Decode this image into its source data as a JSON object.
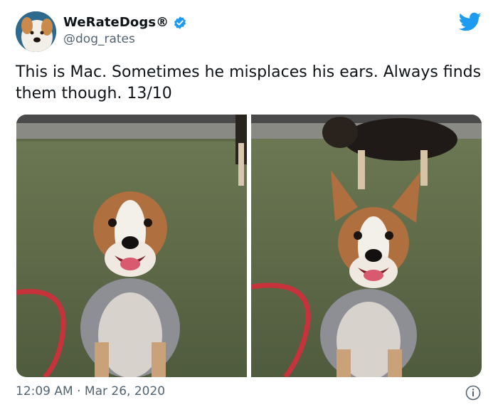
{
  "tweet": {
    "display_name": "WeRateDogs®",
    "handle": "@dog_rates",
    "verified": true,
    "text": "This is Mac. Sometimes he misplaces his ears. Always finds them though. 13/10",
    "time": "12:09 AM",
    "separator": "·",
    "date": "Mar 26, 2020"
  },
  "icons": {
    "verified": "verified-badge-icon",
    "brand": "twitter-bird-icon",
    "info": "info-icon"
  },
  "colors": {
    "accent": "#1d9bf0",
    "text": "#0f1419",
    "secondary": "#536471"
  }
}
